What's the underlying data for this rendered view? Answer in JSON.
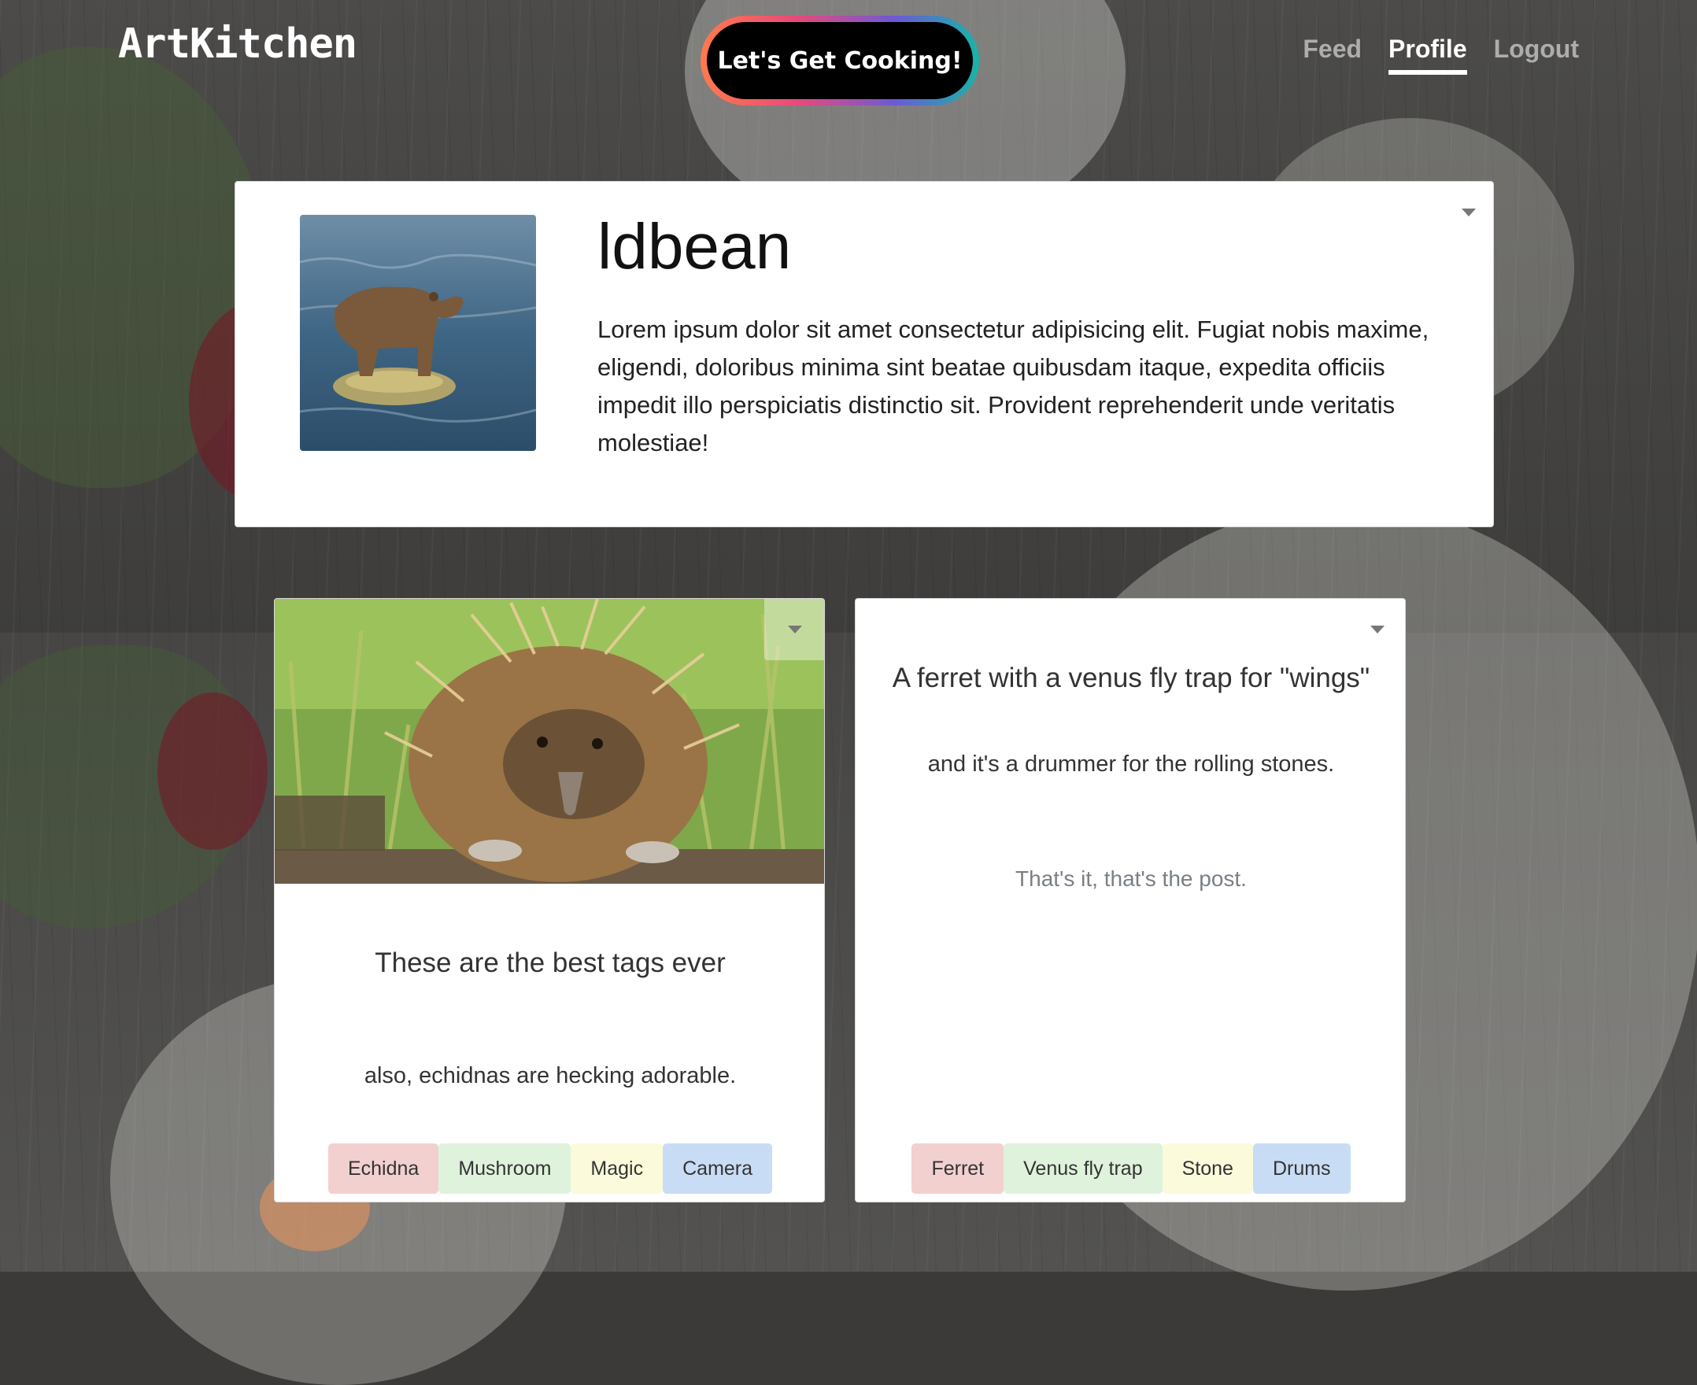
{
  "header": {
    "brand": "ArtKitchen",
    "cta_label": "Let's Get Cooking!",
    "nav": [
      {
        "label": "Feed",
        "active": false
      },
      {
        "label": "Profile",
        "active": true
      },
      {
        "label": "Logout",
        "active": false
      }
    ]
  },
  "profile": {
    "name": "ldbean",
    "bio": "Lorem ipsum dolor sit amet consectetur adipisicing elit. Fugiat nobis maxime, eligendi, doloribus minima sint beatae quibusdam itaque, expedita officiis impedit illo perspiciatis distinctio sit. Provident reprehenderit unde veritatis molestiae!",
    "avatar_icon": "bear-photo"
  },
  "posts": [
    {
      "image_icon": "echidna-photo",
      "title": "These are the best tags ever",
      "body": "also, echidnas are hecking adorable.",
      "tags": [
        "Echidna",
        "Mushroom",
        "Magic",
        "Camera"
      ]
    },
    {
      "title": "A ferret with a venus fly trap for \"wings\"",
      "subtitle": "and it's a drummer for the rolling stones.",
      "body": "That's it, that's the post.",
      "tags": [
        "Ferret",
        "Venus fly trap",
        "Stone",
        "Drums"
      ]
    }
  ],
  "colors": {
    "tag_red": "#f2d0d0",
    "tag_green": "#dff2dc",
    "tag_yellow": "#fbfadb",
    "tag_blue": "#c9dcf5",
    "cta_gradient": [
      "#ff7a4d",
      "#e8497a",
      "#6a5ad6",
      "#19b4a6"
    ]
  }
}
